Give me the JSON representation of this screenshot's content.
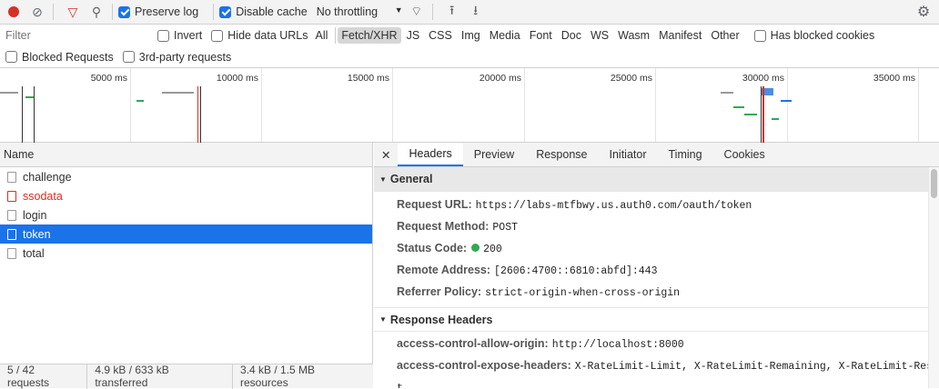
{
  "toolbar": {
    "preserve_log": "Preserve log",
    "disable_cache": "Disable cache",
    "throttling": "No throttling"
  },
  "filter": {
    "placeholder": "Filter",
    "invert": "Invert",
    "hide_data_urls": "Hide data URLs",
    "types": [
      "All",
      "Fetch/XHR",
      "JS",
      "CSS",
      "Img",
      "Media",
      "Font",
      "Doc",
      "WS",
      "Wasm",
      "Manifest",
      "Other"
    ],
    "active_type": "Fetch/XHR",
    "has_blocked_cookies": "Has blocked cookies",
    "blocked_requests": "Blocked Requests",
    "third_party": "3rd-party requests"
  },
  "timeline": {
    "ticks": [
      "5000 ms",
      "10000 ms",
      "15000 ms",
      "20000 ms",
      "25000 ms",
      "30000 ms",
      "35000 ms"
    ]
  },
  "list": {
    "header": "Name",
    "rows": [
      {
        "name": "challenge"
      },
      {
        "name": "ssodata",
        "status": "error"
      },
      {
        "name": "login"
      },
      {
        "name": "token",
        "selected": true
      },
      {
        "name": "total"
      }
    ]
  },
  "status": {
    "requests": "5 / 42 requests",
    "transferred": "4.9 kB / 633 kB transferred",
    "resources": "3.4 kB / 1.5 MB resources"
  },
  "details": {
    "tabs": [
      "Headers",
      "Preview",
      "Response",
      "Initiator",
      "Timing",
      "Cookies"
    ],
    "active_tab": "Headers",
    "general": {
      "title": "General",
      "items": [
        {
          "key": "Request URL:",
          "value": "https://labs-mtfbwy.us.auth0.com/oauth/token"
        },
        {
          "key": "Request Method:",
          "value": "POST"
        },
        {
          "key": "Status Code:",
          "value": "200",
          "status_color": "#1e8e3e"
        },
        {
          "key": "Remote Address:",
          "value": "[2606:4700::6810:abfd]:443"
        },
        {
          "key": "Referrer Policy:",
          "value": "strict-origin-when-cross-origin"
        }
      ]
    },
    "response_headers": {
      "title": "Response Headers",
      "items": [
        {
          "key": "access-control-allow-origin:",
          "value": "http://localhost:8000"
        },
        {
          "key": "access-control-expose-headers:",
          "value": "X-RateLimit-Limit, X-RateLimit-Remaining, X-RateLimit-Rese"
        },
        {
          "key": "",
          "value": "t"
        }
      ]
    }
  }
}
